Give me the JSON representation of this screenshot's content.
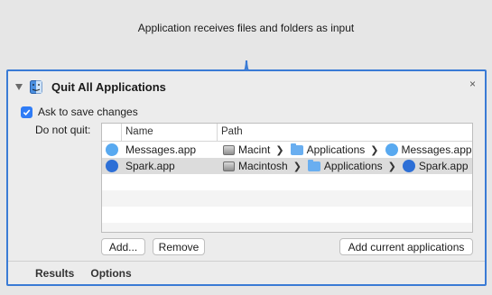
{
  "header": {
    "text": "Application receives files and folders as input"
  },
  "action": {
    "title": "Quit All Applications",
    "close_symbol": "×",
    "ask_to_save": {
      "label": "Ask to save changes",
      "checked": true
    },
    "do_not_quit_label": "Do not quit:",
    "table": {
      "columns": [
        "Name",
        "Path"
      ],
      "rows": [
        {
          "name": "Messages.app",
          "icon": "messages-icon",
          "selected": false,
          "path": [
            "Macint",
            "Applications",
            "Messages.app"
          ]
        },
        {
          "name": "Spark.app",
          "icon": "spark-icon",
          "selected": true,
          "path": [
            "Macintosh",
            "Applications",
            "Spark.app"
          ]
        }
      ]
    },
    "buttons": {
      "add": "Add...",
      "remove": "Remove",
      "add_current": "Add current applications"
    },
    "tabs": [
      "Results",
      "Options"
    ]
  },
  "colors": {
    "accent": "#3a7bd5",
    "checkbox": "#2f7cf6"
  }
}
